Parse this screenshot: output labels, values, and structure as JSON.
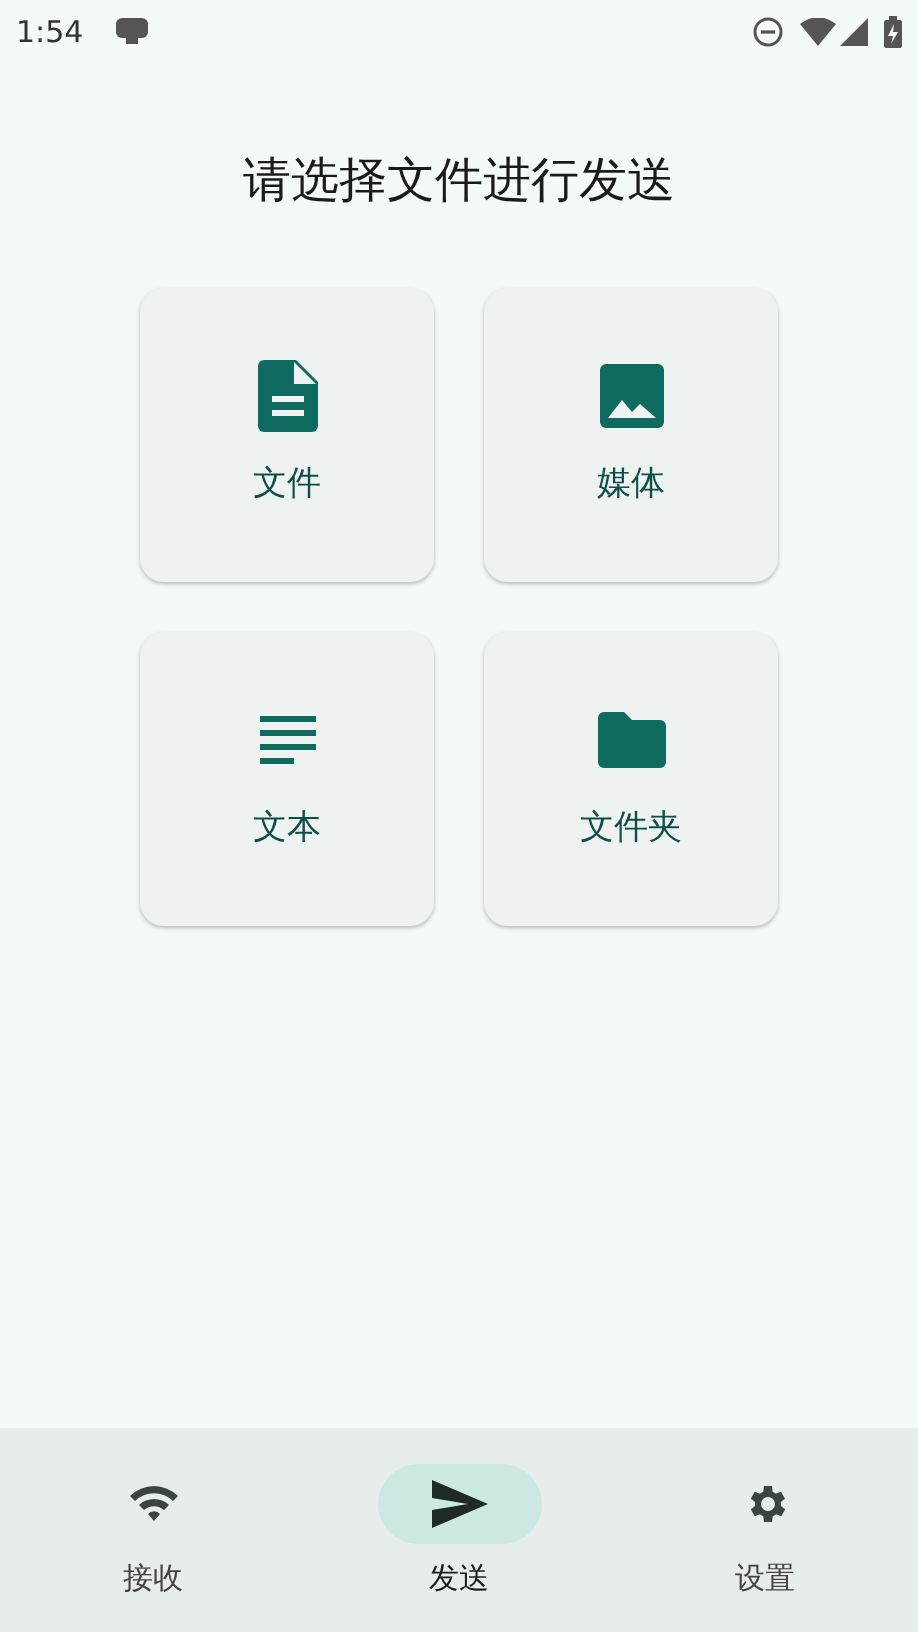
{
  "status_bar": {
    "time": "1:54"
  },
  "title": "请选择文件进行发送",
  "options": [
    {
      "kind": "file",
      "label": "文件"
    },
    {
      "kind": "image",
      "label": "媒体"
    },
    {
      "kind": "text",
      "label": "文本"
    },
    {
      "kind": "folder",
      "label": "文件夹"
    }
  ],
  "nav": [
    {
      "kind": "wifi",
      "label": "接收",
      "selected": false
    },
    {
      "kind": "send",
      "label": "发送",
      "selected": true
    },
    {
      "kind": "gear",
      "label": "设置",
      "selected": false
    }
  ]
}
